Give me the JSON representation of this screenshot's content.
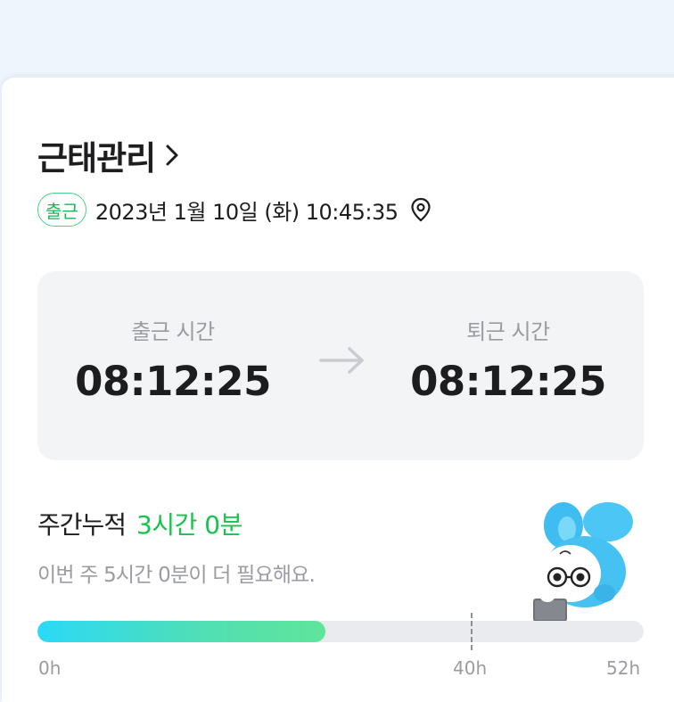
{
  "attendance": {
    "title": "근태관리",
    "status_badge": "출근",
    "datetime": "2023년 1월 10일 (화) 10:45:35",
    "clock_in": {
      "label": "출근 시간",
      "time": "08:12:25"
    },
    "clock_out": {
      "label": "퇴근 시간",
      "time": "08:12:25"
    }
  },
  "weekly": {
    "label": "주간누적",
    "value": "3시간 0분",
    "remaining": "이번 주 5시간 0분이 더 필요해요.",
    "progress_fraction": 0.475,
    "ticks": {
      "start": "0h",
      "target": "40h",
      "max": "52h"
    }
  },
  "colors": {
    "accent_green": "#16c34f",
    "badge_border": "#4cd080",
    "progress_start": "#2bd9f7",
    "progress_end": "#5fe59a"
  },
  "icons": {
    "title_chevron": "chevron-right-icon",
    "location": "location-pin-icon",
    "arrow": "arrow-right-icon",
    "mascot": "rabbit-mascot-illustration"
  }
}
